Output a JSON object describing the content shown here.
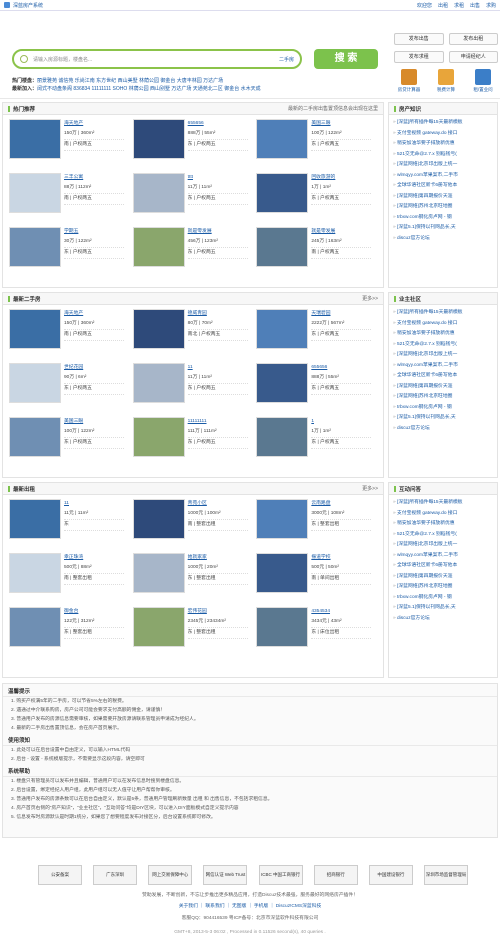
{
  "topbar": {
    "site": "深蓝房产系统",
    "links": [
      "欢迎您",
      "出租",
      "求租",
      "出售",
      "求购"
    ]
  },
  "search": {
    "placeholder": "请输入房源标题，楼盘名...",
    "select": "二手房",
    "button": "搜 索"
  },
  "hot": {
    "label": "热门楼盘：",
    "items": "丽景雅苑 诚信苑 乐尚江南 东方世纪 西山美墅 林荫公园 御金台 大唐丰林园 万达广场",
    "label2": "最新加入：",
    "items2": "阔式不动盘条阁 836834 11111111 SOHO 林荫公园 西山别墅 万达广场 天通苑北二区 御金台 水木天成"
  },
  "right_buttons": [
    "发布出售",
    "发布出租",
    "发布求租",
    "申请经纪人"
  ],
  "right_icons": [
    "房贷计算器",
    "税费计算",
    "租/置业问"
  ],
  "sections": {
    "hot": "热门推荐",
    "hot_note": "最新的二手房出售置顶信息会出现在这里",
    "second": "最新二手房",
    "rent": "最新出租",
    "more": "更多>>",
    "news": "房产知识",
    "forum": "业主社区",
    "qa": "互动问答"
  },
  "hot_cards": [
    {
      "name": "海天地产",
      "a": "150万",
      "b": "360m²",
      "c": "南",
      "d": "户权两五"
    },
    {
      "name": "655656",
      "a": "888万",
      "b": "55m²",
      "c": "东",
      "d": "户权两五"
    },
    {
      "name": "美国三眼",
      "a": "100万",
      "b": "122m²",
      "c": "东",
      "d": "户权两五"
    },
    {
      "name": "三丰公寓",
      "a": "88万",
      "b": "112m²",
      "c": "南",
      "d": "户权两五"
    },
    {
      "name": "tttt",
      "a": "11万",
      "b": "11m²",
      "c": "东",
      "d": "户权两五"
    },
    {
      "name": "回收旅游的",
      "a": "1万",
      "b": "1m²",
      "c": "东",
      "d": "户权两五"
    },
    {
      "name": "学期五",
      "a": "30万",
      "b": "122m²",
      "c": "东",
      "d": "户权两五"
    },
    {
      "name": "就是零发展",
      "a": "456万",
      "b": "123m²",
      "c": "东",
      "d": "户权两五"
    },
    {
      "name": "就是零发展",
      "a": "245万",
      "b": "163m²",
      "c": "南",
      "d": "户权两五"
    }
  ],
  "second_cards": [
    {
      "name": "海天地产",
      "a": "150万",
      "b": "360m²",
      "c": "南",
      "d": "户权两五"
    },
    {
      "name": "德威青园",
      "a": "80万",
      "b": "70m²",
      "c": "南北",
      "d": "户权两五"
    },
    {
      "name": "天瑞碧园",
      "a": "2222万",
      "b": "567m²",
      "c": "东",
      "d": "户权两五"
    },
    {
      "name": "世纪花园",
      "a": "90万",
      "b": "6m²",
      "c": "东",
      "d": "户权两五"
    },
    {
      "name": "11",
      "a": "11万",
      "b": "11m²",
      "c": "东",
      "d": "户权两五"
    },
    {
      "name": "655656",
      "a": "888万",
      "b": "55m²",
      "c": "东",
      "d": "户权两五"
    },
    {
      "name": "美国三眼",
      "a": "100万",
      "b": "122m²",
      "c": "东",
      "d": "户权两五"
    },
    {
      "name": "11111111",
      "a": "111万",
      "b": "111m²",
      "c": "东",
      "d": "户权两五"
    },
    {
      "name": "1",
      "a": "1万",
      "b": "1m²",
      "c": "东",
      "d": "户权两五"
    }
  ],
  "rent_cards": [
    {
      "name": "11",
      "a": "11元",
      "b": "11m²",
      "c": "东",
      "d": ""
    },
    {
      "name": "青苑小区",
      "a": "1000元",
      "b": "100m²",
      "c": "南",
      "d": "整套出租"
    },
    {
      "name": "云南路盘",
      "a": "3000元",
      "b": "108m²",
      "c": "东",
      "d": "整套出租"
    },
    {
      "name": "幸正珠湾",
      "a": "500元",
      "b": "88m²",
      "c": "南",
      "d": "整套出租"
    },
    {
      "name": "她就家家",
      "a": "1000元",
      "b": "20m²",
      "c": "东",
      "d": "整套出租"
    },
    {
      "name": "振道学校",
      "a": "500元",
      "b": "50m²",
      "c": "南",
      "d": "单间出租"
    },
    {
      "name": "御金台",
      "a": "122元",
      "b": "312m²",
      "c": "东",
      "d": "整套出租"
    },
    {
      "name": "宏伟花园",
      "a": "2345元",
      "b": "23434m²",
      "c": "东",
      "d": "整套出租"
    },
    {
      "name": "4354534",
      "a": "3434元",
      "b": "43m²",
      "c": "东",
      "d": "床位出租"
    }
  ],
  "news_list": [
    "[深蓝]所有插件每15天最新模板",
    "支付宝视频 gateway.do 接口",
    "稍安加油华要子排放新优惠",
    "521交无命@2.7.x 别稻钱亏(",
    "[深蓝网络]北京印出版上统一",
    "wlmqyy.com苹果案市,二手市",
    "全球华语社区新卡6册写他本",
    "[深蓝网络]第四期报价天涯",
    "[深蓝网络]苏州北京旺地圈",
    "trbxw.com钢化房卢网 - 钢",
    "[深蓝5.1]保持以刊网品长,天",
    "discuz官方论坛"
  ],
  "forum_list": [
    "[深蓝]所有插件每15天最新模板",
    "支付宝视频 gateway.do 接口",
    "稍安加油华要子排放新优惠",
    "521交无命@2.7.x 别稻钱亏(",
    "[深蓝网络]北京印出版上统一",
    "wlmqyy.com苹果案市,二手市",
    "全球华语社区新卡6册写他本",
    "[深蓝网络]第四期报价天涯",
    "[深蓝网络]苏州北京旺地圈",
    "trbxw.com钢化房卢网 - 钢",
    "[深蓝5.1]保持以刊网品长,天",
    "discuz官方论坛"
  ],
  "qa_list": [
    "[深蓝]所有插件每15天最新模板",
    "支付宝视频 gateway.do 接口",
    "稍安加油华要子排放新优惠",
    "521交无命@2.7.x 别稻钱亏(",
    "[深蓝网络]北京印出版上统一",
    "wlmqyy.com苹果案市,二手市",
    "全球华语社区新卡6册写他本",
    "[深蓝网络]第四期报价天涯",
    "[深蓝网络]苏州北京旺地圈",
    "trbxw.com钢化房卢网 - 钢",
    "[深蓝5.1]保持以刊网品长,天",
    "discuz官方论坛"
  ],
  "notice": [
    {
      "title": "温馨提示",
      "lines": [
        "1. 购买产权满5年的二手房，可以节省5%左右的税费。",
        "2. 遇通过中介联系购房，房产公司可能会要求支付高额的佣金，请谨慎！",
        "3. 普通用户发布的房源信息需要审核，如果需要开放房源请联系管理员申请成为经纪人。",
        "4. 最新的二手房出售置顶信息，会在房产首页展示。"
      ]
    },
    {
      "title": "使用须知",
      "lines": [
        "1. 此处可以在后台设置中自由定义，可以输入HTML代码",
        "2. 后台 - 设置 - 系统模版提示，不需要显示这段内容，请空即可"
      ]
    },
    {
      "title": "系统帮助",
      "lines": [
        "1. 楼盘只有管理员可以发布并且编辑，普通用户可以在发布信息时搜到楼盘信息。",
        "2. 后台设置，绑定经纪人用户组，此用户组可以无人值守让用户帮帮你审核。",
        "3. 普通用户发布的房源条数可以在后台自由定义，默认是5条，普通用户管理刷新数量 出租 和 出售信息，不包括求租信息。",
        "4. 房产首页右侧的“房产知识”，“业主社区”，“互动问答”均是DIY区块，可以进入DIY面板模式自定义提示内容",
        "5. 信息发布时房源默认是时期1统分，如果您了想要程度发布对接区分，后台设置系统即可修改。"
      ]
    }
  ],
  "badges": [
    "公安备案",
    "广东深圳",
    "网上交易保障中心",
    "网信认证 Web Trust",
    "ICBC 中国工商银行",
    "招商银行",
    "中国建设银行",
    "深圳市场监督管理局"
  ],
  "footer": {
    "line1": "赞助发展，不断创新，不忘让步推出更多精品应用，打造Discuz技术最强，服务最好的网络房产插件！",
    "links": "关于我们 ｜ 联系我们 ｜ 无图版 ｜ 手机版 ｜ Discuz!CMS深蓝科技",
    "line2": "客服QQ：904416539 粤ICP备号：北京市深蓝软件科技有限公司",
    "line3": "GMT+8, 2013-5-3 06:02 , Processed in 0.11526 second(s), 40 queries ."
  }
}
